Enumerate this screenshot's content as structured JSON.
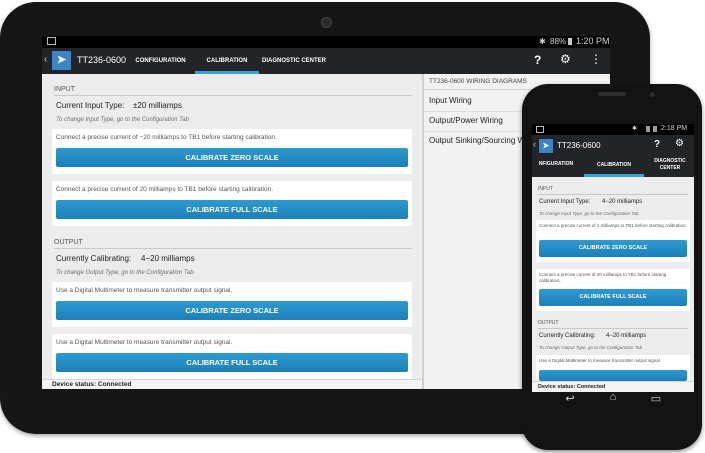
{
  "tablet": {
    "status": {
      "battery": "88%",
      "time": "1:20 PM"
    },
    "app_title": "TT236-0600",
    "tabs": [
      {
        "label": "CONFIGURATION"
      },
      {
        "label": "CALIBRATION"
      },
      {
        "label": "DIAGNOSTIC CENTER"
      }
    ],
    "input": {
      "header": "INPUT",
      "type_label": "Current Input Type:",
      "type_value": "±20 milliamps",
      "hint": "To change Input Type, go to the Configuration Tab",
      "zero_instruction": "Connect a precise current of −20 milliamps to TB1 before starting calibration.",
      "zero_button": "CALIBRATE ZERO SCALE",
      "full_instruction": "Connect a precise current of 20 milliamps to TB1 before starting calibration.",
      "full_button": "CALIBRATE FULL SCALE"
    },
    "output": {
      "header": "OUTPUT",
      "cal_label": "Currently Calibrating:",
      "cal_value": "4−20 milliamps",
      "hint": "To change Output Type, go to the Configuration Tab",
      "zero_instruction": "Use a Digital Multimeter to measure transmitter output signal.",
      "zero_button": "CALIBRATE ZERO SCALE",
      "full_instruction": "Use a Digital Multimeter to measure transmitter output signal.",
      "full_button": "CALIBRATE FULL SCALE"
    },
    "device_status": "Device status:  Connected",
    "wiring": {
      "header": "TT236-0600 WIRING DIAGRAMS",
      "items": [
        "Input Wiring",
        "Output/Power Wiring",
        "Output Sinking/Sourcing W"
      ]
    }
  },
  "phone": {
    "status": {
      "time": "2:18 PM"
    },
    "app_title": "TT236-0600",
    "tabs": [
      {
        "label": "NFIGURATION"
      },
      {
        "label": "CALIBRATION"
      },
      {
        "label": "DIAGNOSTIC CENTER"
      }
    ],
    "input": {
      "header": "INPUT",
      "type_label": "Current Input Type:",
      "type_value": "4−20 milliamps",
      "hint": "To change Input Type, go to the Configuration Tab",
      "zero_instruction": "Connect a precise current of 4 milliamps to TB1 before starting calibration.",
      "zero_button": "CALIBRATE ZERO SCALE",
      "full_instruction": "Connect a precise current of 20 milliamps to TB1 before starting calibration.",
      "full_button": "CALIBRATE FULL SCALE"
    },
    "output": {
      "header": "OUTPUT",
      "cal_label": "Currently Calibrating:",
      "cal_value": "4−20 milliamps",
      "hint": "To change Output Type, go to the Configuration Tab",
      "zero_instruction": "Use a Digital Multimeter to measure transmitter output signal."
    },
    "device_status": "Device status:  Connected"
  },
  "icons": {
    "back": "chevron-left",
    "logo": "app-logo",
    "help": "?",
    "settings": "gear",
    "overflow": "⋮",
    "nav_back": "↩",
    "nav_home": "⌂",
    "nav_recent": "▭"
  },
  "colors": {
    "accent": "#1d7fb8",
    "action_bar": "#222427",
    "screen_bg": "#ececec"
  }
}
